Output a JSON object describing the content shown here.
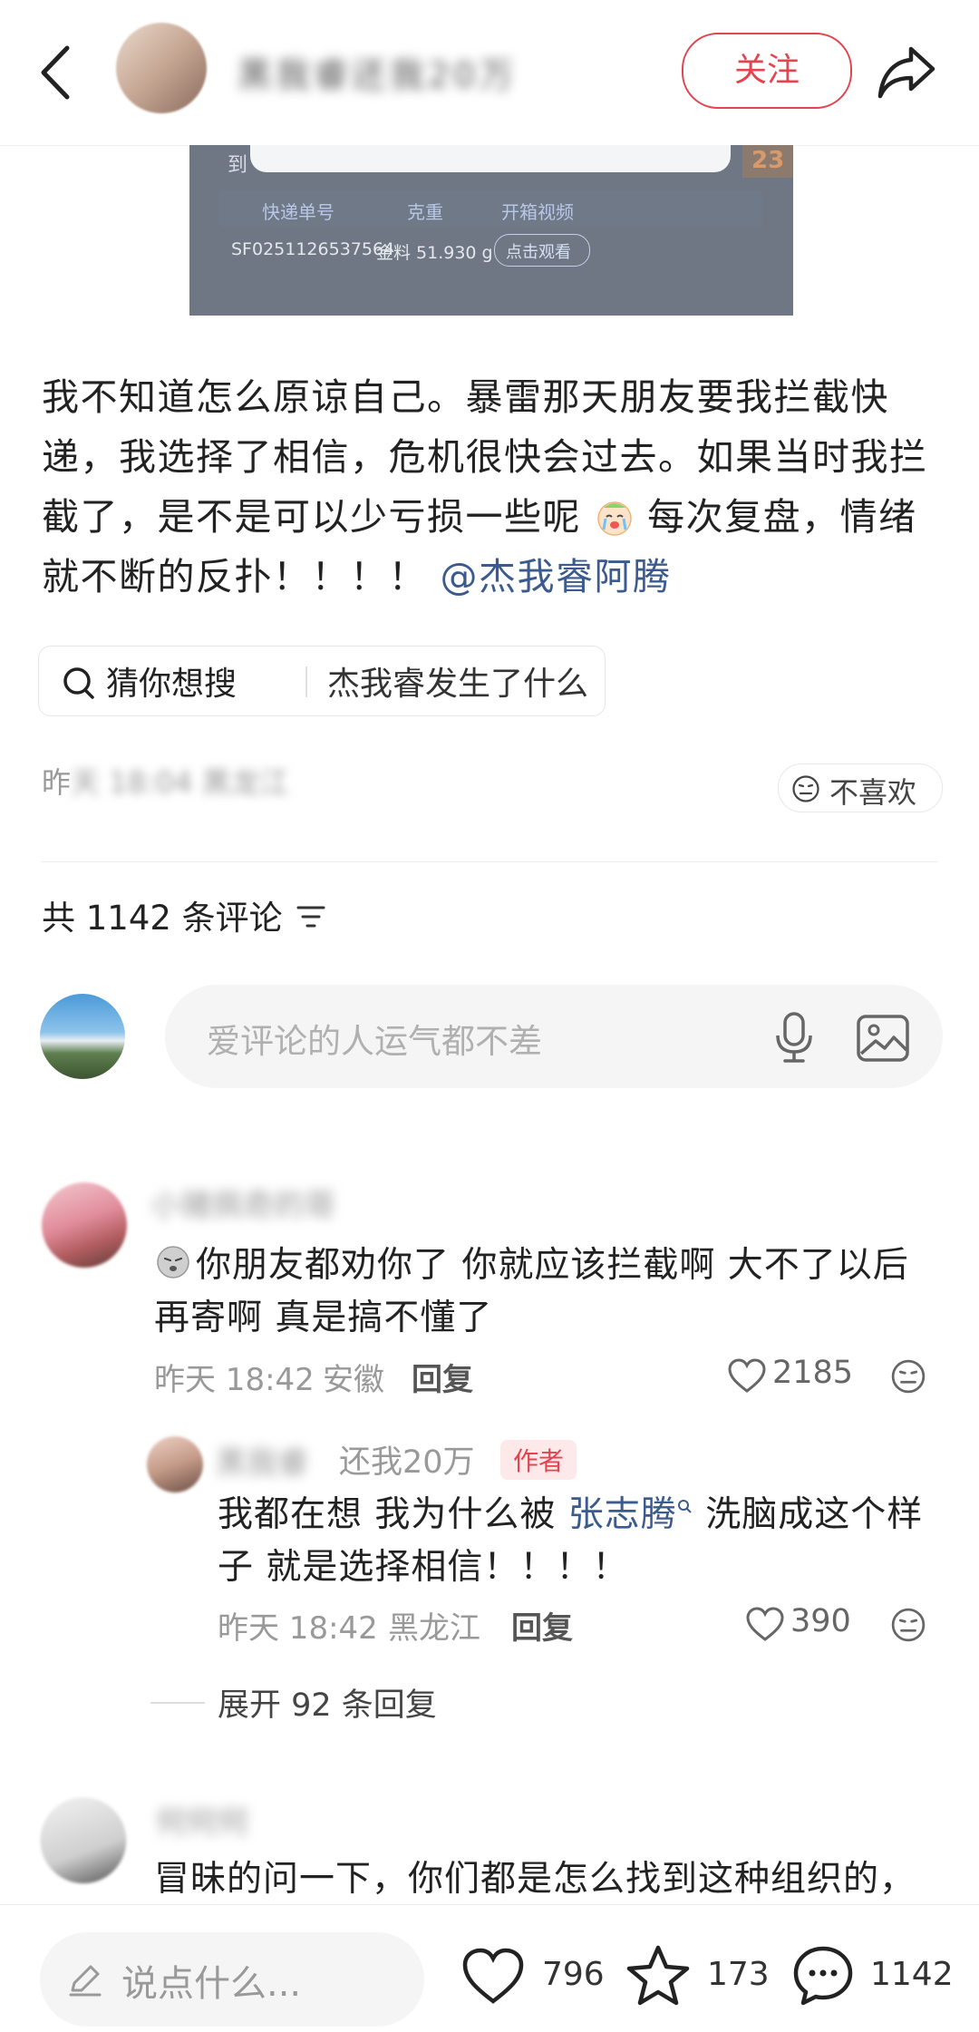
{
  "header": {
    "author_name_blurred": "黑我睿还我20万",
    "follow_label": "关注"
  },
  "image_fragment": {
    "left_char": "到",
    "badge_num": "23",
    "col1": "快递单号",
    "col2": "克重",
    "col3": "开箱视频",
    "tracking": "SF0251126537564",
    "weight": "金料 51.930 g",
    "watch": "点击观看"
  },
  "post": {
    "text_parts": [
      "我不知道怎么原谅自己。暴雷那天朋友要我拦截快递，我选择了相信，危机很快会过去。如果当时我拦截了，是不是可以少亏损一些呢",
      "每次复盘，情绪就不断的反扑！！！！"
    ],
    "mention": "@杰我睿阿腾"
  },
  "search_chip": {
    "label": "猜你想搜",
    "query": "杰我睿发生了什么"
  },
  "meta": {
    "time_first": "昨",
    "time_blurred": "天 18:04 黑龙江",
    "dislike": "不喜欢"
  },
  "comments_header": {
    "count_label": "共 1142 条评论"
  },
  "comment_input": {
    "placeholder": "爱评论的人运气都不差"
  },
  "comments": [
    {
      "name_blurred": "小猪佩奇的哥",
      "text": "你朋友都劝你了 你就应该拦截啊 大不了以后再寄啊 真是搞不懂了",
      "time": "昨天 18:42",
      "location": "安徽",
      "reply": "回复",
      "likes": "2185",
      "reply_item": {
        "name_blurred": "黑我睿",
        "name_visible": "还我20万",
        "author_badge": "作者",
        "text_before": "我都在想 我为什么被 ",
        "link": "张志腾",
        "text_after": " 洗脑成这个样子 就是选择相信！！！！",
        "time": "昨天 18:42",
        "location": "黑龙江",
        "reply": "回复",
        "likes": "390"
      },
      "expand": "展开 92 条回复"
    },
    {
      "name_blurred": "何何何",
      "text": "冒昧的问一下，你们都是怎么找到这种组织的，"
    }
  ],
  "bottom_bar": {
    "say_placeholder": "说点什么...",
    "likes": "796",
    "stars": "173",
    "comments": "1142"
  }
}
